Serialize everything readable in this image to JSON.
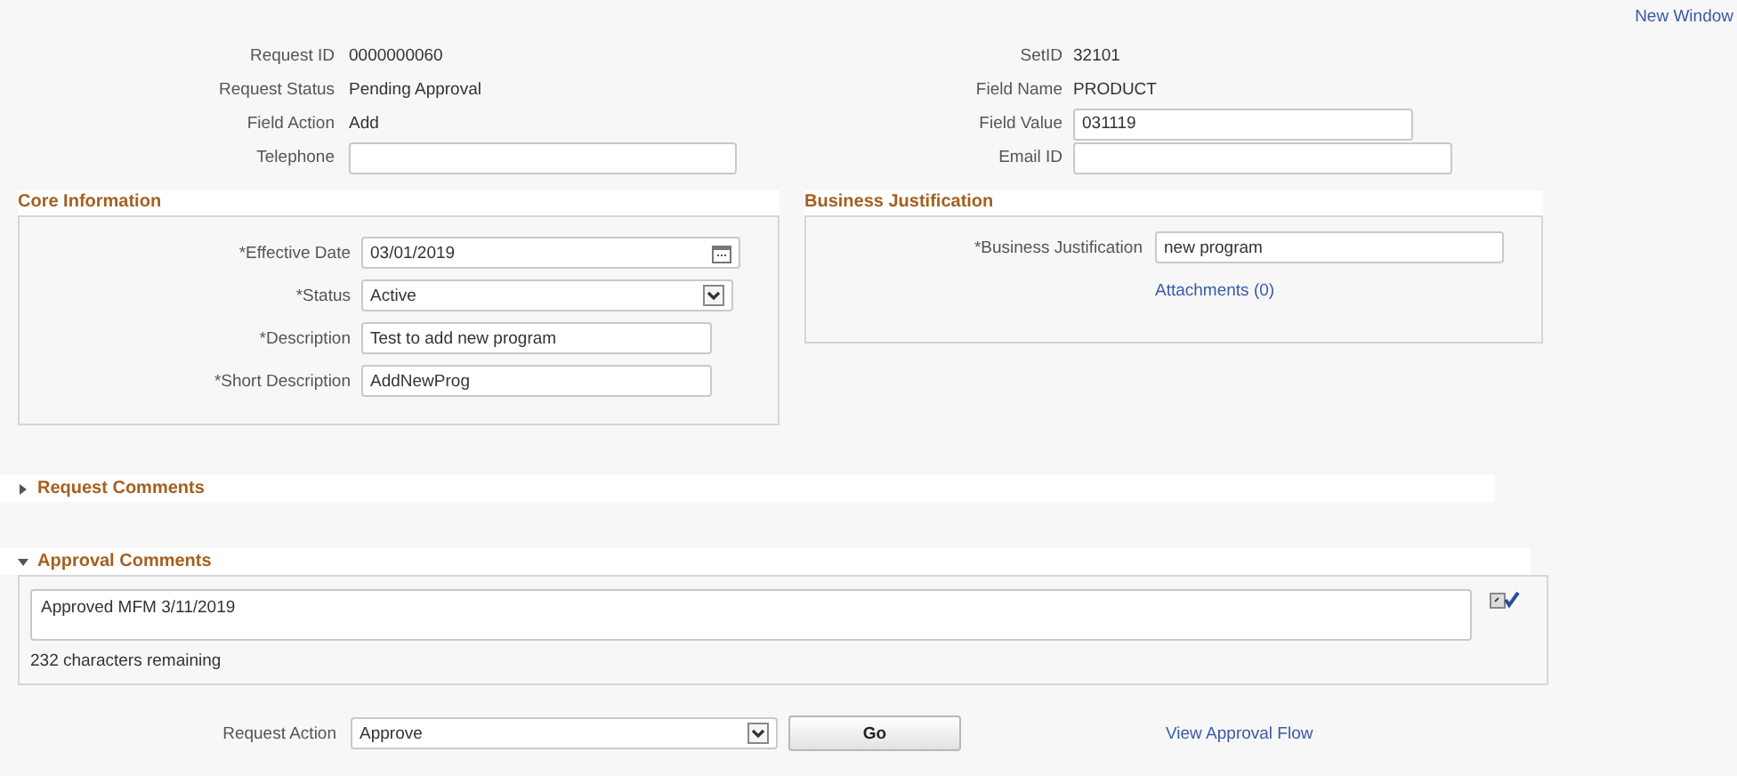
{
  "new_window_link": "New Window",
  "request_info": {
    "left": [
      {
        "label": "Request ID",
        "value": "0000000060",
        "kind": "text"
      },
      {
        "label": "Request Status",
        "value": "Pending Approval",
        "kind": "text"
      },
      {
        "label": "Field Action",
        "value": "Add",
        "kind": "text"
      },
      {
        "label": "Telephone",
        "kind": "input"
      }
    ],
    "right": [
      {
        "label": "SetID",
        "value": "32101",
        "kind": "text"
      },
      {
        "label": "Field Name",
        "value": "PRODUCT",
        "kind": "text"
      },
      {
        "label": "Field Value",
        "value": "031119",
        "kind": "input"
      },
      {
        "label": "Email ID",
        "kind": "input"
      }
    ]
  },
  "core_information": {
    "title": "Core Information",
    "fields": [
      {
        "label": "*Effective Date",
        "value": "03/01/2019",
        "kind": "date"
      },
      {
        "label": "*Status",
        "value": "Active",
        "kind": "select"
      },
      {
        "label": "*Description",
        "value": "Test to add new program",
        "kind": "input"
      },
      {
        "label": "*Short Description",
        "value": "AddNewProg",
        "kind": "input"
      }
    ]
  },
  "business_justification": {
    "title": "Business Justification",
    "field": {
      "label": "*Business Justification",
      "value": "new program"
    },
    "link": "Attachments (0)"
  },
  "request_comments": {
    "title": "Request Comments",
    "expanded": false
  },
  "approval_comments": {
    "title": "Approval Comments",
    "expanded": true,
    "value": "Approved MFM 3/11/2019",
    "remaining": "232 characters remaining"
  },
  "footer": {
    "label": "Request Action",
    "value": "Approve",
    "button": "Go",
    "link": "View Approval Flow"
  }
}
